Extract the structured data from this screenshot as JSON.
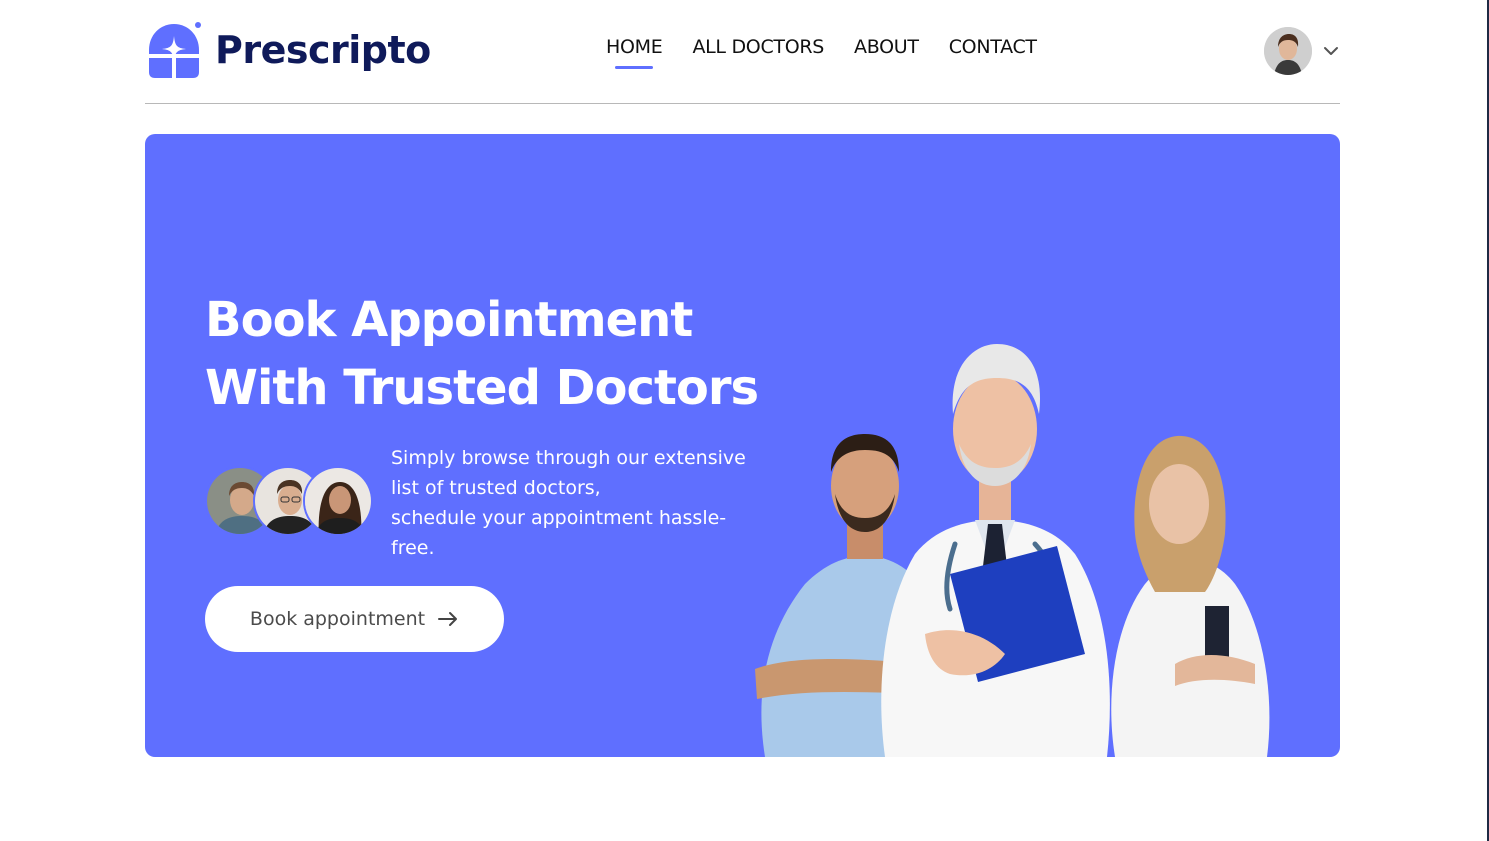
{
  "brand": {
    "name": "Prescripto",
    "color": "#0f1a5a",
    "accent": "#5f6fff"
  },
  "nav": {
    "items": [
      {
        "label": "HOME",
        "active": true
      },
      {
        "label": "ALL DOCTORS",
        "active": false
      },
      {
        "label": "ABOUT",
        "active": false
      },
      {
        "label": "CONTACT",
        "active": false
      }
    ]
  },
  "profile": {
    "avatar_icon": "user-avatar",
    "menu_icon": "chevron-down-icon"
  },
  "hero": {
    "background": "#5f6fff",
    "title_line1": "Book Appointment",
    "title_line2": "With Trusted Doctors",
    "desc_line1": "Simply browse through our extensive",
    "desc_line2": "list of trusted doctors,",
    "desc_line3": "schedule your appointment hassle-",
    "desc_line4": "free.",
    "cta_label": "Book appointment",
    "cta_icon": "arrow-right-icon"
  }
}
